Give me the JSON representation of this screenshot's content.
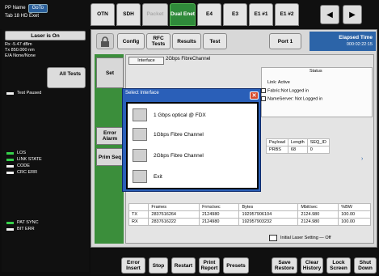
{
  "header": {
    "pp_name": "PP Name",
    "goto_label": "GoTo",
    "tab_name": "Tab 18 HD Exet",
    "tabs": [
      {
        "label": "OTN",
        "state": "normal"
      },
      {
        "label": "SDH",
        "state": "normal"
      },
      {
        "label": "Packet",
        "state": "disabled"
      },
      {
        "label": "Dual Enet",
        "state": "active"
      },
      {
        "label": "E4",
        "state": "normal"
      },
      {
        "label": "E3",
        "state": "normal"
      },
      {
        "label": "E1 #1",
        "state": "normal"
      },
      {
        "label": "E1 #2",
        "state": "normal"
      }
    ],
    "nav_left": "◀",
    "nav_right": "▶"
  },
  "left_panel": {
    "laser_button": "Laser is On",
    "rx_lines": [
      "Rx -5.47 dBm",
      "Tx 850.000 nm",
      "E/A None/None"
    ],
    "all_tests": "All Tests",
    "test_paused": "Test Paused",
    "leds_group1": [
      {
        "label": "LOS",
        "color": "green"
      },
      {
        "label": "LINK STATE",
        "color": "green"
      },
      {
        "label": "CODE",
        "color": "white"
      },
      {
        "label": "CRC ERR",
        "color": "white"
      }
    ],
    "leds_group2": [
      {
        "label": "PAT SYNC",
        "color": "green"
      },
      {
        "label": "BIT ERR",
        "color": "white"
      }
    ]
  },
  "toolbar": {
    "config": "Config",
    "rfc_tests": "RFC Tests",
    "results": "Results",
    "test": "Test",
    "port": "Port 1",
    "elapsed_label": "Elapsed Time",
    "elapsed_value": "000:02:22:15"
  },
  "side_buttons": {
    "set": "Set",
    "error_alarm": "Error Alarm",
    "prim_seq": "Prim Seq"
  },
  "interface": {
    "label": "Interface",
    "value": "2Gbps FibreChannel"
  },
  "status": {
    "header": "Status",
    "link": "Link: Active",
    "fabric": "Fabric:Not Logged in",
    "nameserver": "NameServer: Not Logged in"
  },
  "payload_table": {
    "headers": [
      "Payload",
      "Length",
      "SEQ_ID"
    ],
    "rows": [
      [
        "PRBS",
        "68",
        "0"
      ]
    ]
  },
  "frames_table": {
    "headers": [
      "",
      "Frames",
      "Frms/sec",
      "Bytes",
      "Mbit/sec",
      "%BW"
    ],
    "rows": [
      [
        "TX",
        "2837616264",
        "2124980",
        "192957906104",
        "2124.980",
        "100.00"
      ],
      [
        "RX",
        "2837616222",
        "2124980",
        "192957903232",
        "2124.980",
        "100.00"
      ]
    ]
  },
  "initial_laser": "Initial Laser Setting — Off",
  "dialog": {
    "title": "Select Interface",
    "close": "✕",
    "options": [
      "1 Gbps optical @ FDX",
      "1Gbps Fibre Channel",
      "2Gbps Fibre Channel",
      "Exit"
    ]
  },
  "bottom": {
    "error_insert": "Error Insert",
    "stop": "Stop",
    "restart": "Restart",
    "print_report": "Print Report",
    "presets": "Presets",
    "save_restore": "Save Restore",
    "clear_history": "Clear History",
    "lock_screen": "Lock Screen",
    "shut_down": "Shut Down"
  }
}
